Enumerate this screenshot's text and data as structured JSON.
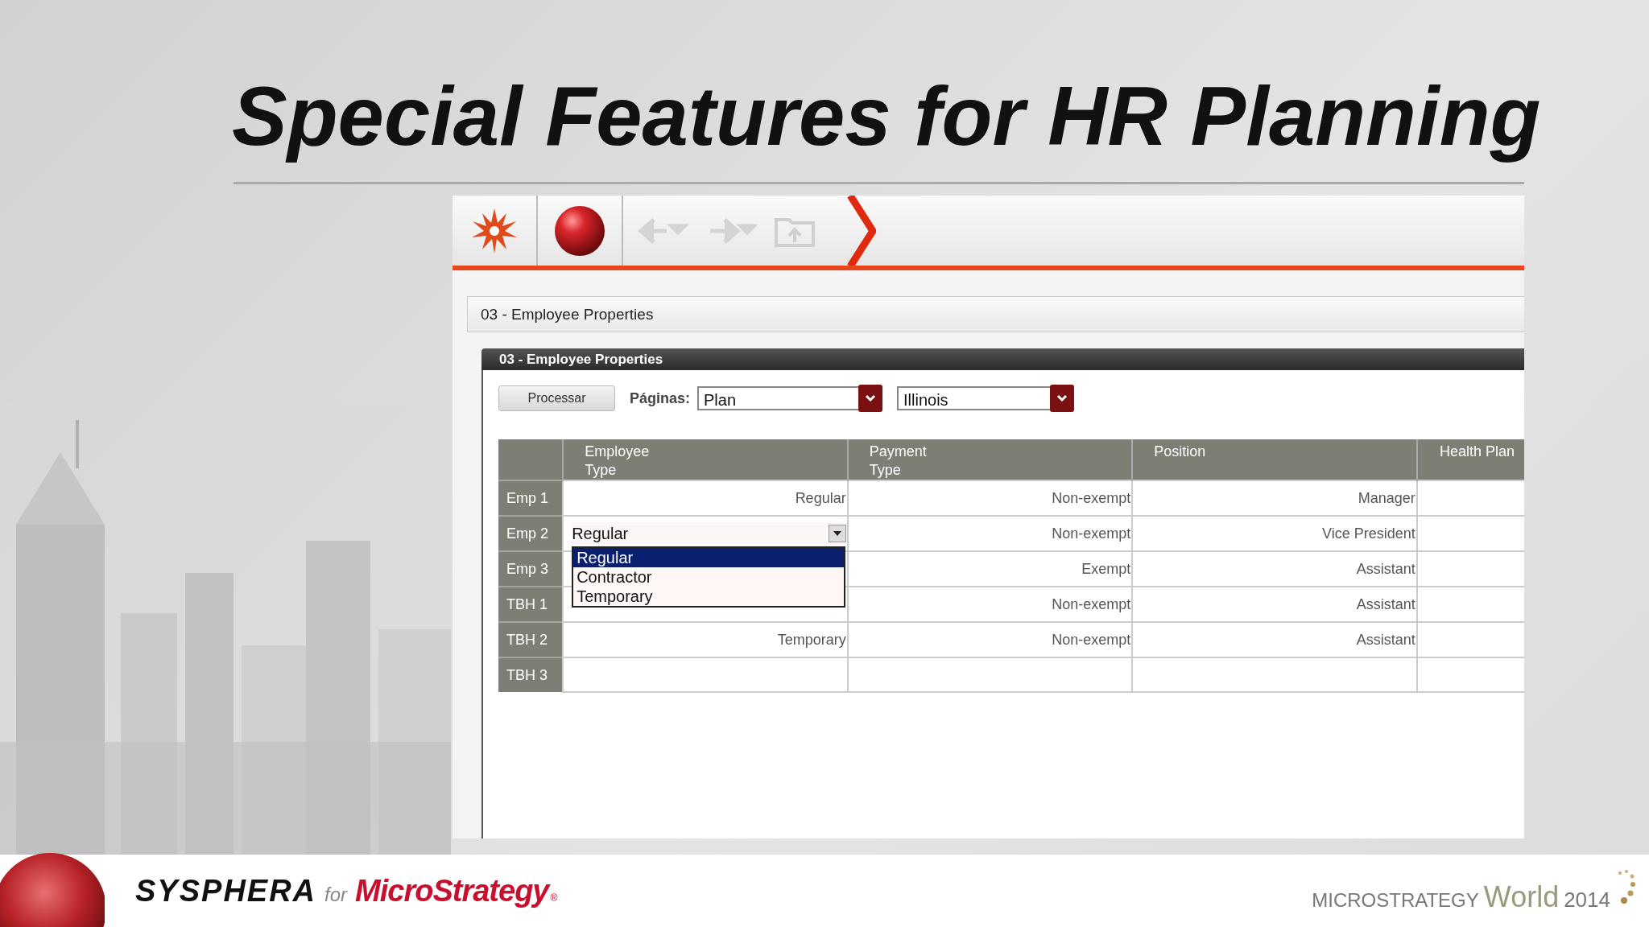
{
  "slide": {
    "title": "Special Features for HR Planning"
  },
  "app": {
    "panel_title": "03 - Employee Properties",
    "report_title": "03 - Employee Properties",
    "process_button": "Processar",
    "pages_label": "Páginas:",
    "page_selects": [
      {
        "value": "Plan"
      },
      {
        "value": "Illinois"
      }
    ],
    "table": {
      "columns": [
        "Employee\nType",
        "Payment\nType",
        "Position",
        "Health Plan"
      ],
      "rows": [
        {
          "header": "Emp 1",
          "cells": [
            {
              "kind": "text",
              "value": "Regular"
            },
            {
              "kind": "text",
              "value": "Non-exempt"
            },
            {
              "kind": "text",
              "value": "Manager"
            }
          ]
        },
        {
          "header": "Emp 2",
          "cells": [
            {
              "kind": "select",
              "value": "Regular",
              "options": [
                {
                  "label": "Regular",
                  "selected": true
                },
                {
                  "label": "Contractor",
                  "selected": false
                },
                {
                  "label": "Temporary",
                  "selected": false
                }
              ]
            },
            {
              "kind": "text",
              "value": "Non-exempt"
            },
            {
              "kind": "text",
              "value": "Vice President"
            }
          ]
        },
        {
          "header": "Emp 3",
          "cells": [
            {
              "kind": "blank"
            },
            {
              "kind": "text",
              "value": "Exempt"
            },
            {
              "kind": "text",
              "value": "Assistant"
            }
          ]
        },
        {
          "header": "TBH 1",
          "cells": [
            {
              "kind": "blank"
            },
            {
              "kind": "text",
              "value": "Non-exempt"
            },
            {
              "kind": "text",
              "value": "Assistant"
            }
          ]
        },
        {
          "header": "TBH 2",
          "cells": [
            {
              "kind": "text",
              "value": "Temporary"
            },
            {
              "kind": "text",
              "value": "Non-exempt"
            },
            {
              "kind": "text",
              "value": "Assistant"
            }
          ]
        },
        {
          "header": "TBH 3",
          "cells": [
            {
              "kind": "blank"
            },
            {
              "kind": "blank"
            },
            {
              "kind": "blank"
            }
          ]
        }
      ]
    }
  },
  "footer": {
    "brand": "SYSPHERA",
    "connector": "for",
    "partner": "MicroStrategy",
    "mark": "®",
    "event_name": "MICROSTRATEGY",
    "event_word": "World",
    "event_year": "2014"
  }
}
